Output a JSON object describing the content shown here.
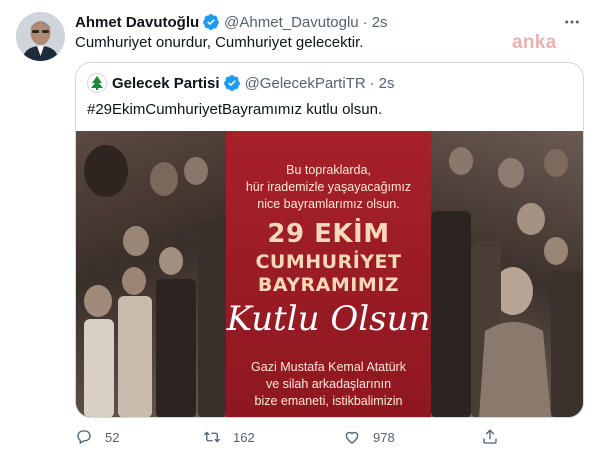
{
  "tweet": {
    "author_name": "Ahmet Davutoğlu",
    "author_handle": "@Ahmet_Davutoglu",
    "separator": "·",
    "time": "2s",
    "text": "Cumhuriyet onurdur, Cumhuriyet gelecektir.",
    "avatar_icon": "profile-photo",
    "verified_icon": "verified-badge-icon",
    "more_icon": "more-options-icon"
  },
  "watermark": "anka",
  "quoted_tweet": {
    "author_name": "Gelecek Partisi",
    "author_handle": "@GelecekPartiTR",
    "separator": "·",
    "time": "2s",
    "text": "#29EkimCumhuriyetBayramımız kutlu olsun.",
    "avatar_icon": "party-logo",
    "media": {
      "lines_top": [
        "Bu topraklarda,",
        "hür irademizle yaşayacağımız",
        "nice bayramlarımız olsun."
      ],
      "headline": [
        "29 EKİM",
        "CUMHURİYET",
        "BAYRAMIMIZ"
      ],
      "script": "Kutlu Olsun",
      "lines_bottom": [
        "Gazi Mustafa Kemal Atatürk",
        "ve silah arkadaşlarının",
        "bize emaneti, istikbalimizin"
      ]
    }
  },
  "actions": {
    "reply_count": "52",
    "retweet_count": "162",
    "like_count": "978",
    "reply_icon": "reply-icon",
    "retweet_icon": "retweet-icon",
    "like_icon": "like-icon",
    "share_icon": "share-icon"
  },
  "colors": {
    "text_primary": "#0f1419",
    "text_secondary": "#536471",
    "verified_blue": "#1d9bf0",
    "border": "#cfd9de",
    "banner_red": "#a7202a",
    "watermark_red": "#d65050"
  }
}
